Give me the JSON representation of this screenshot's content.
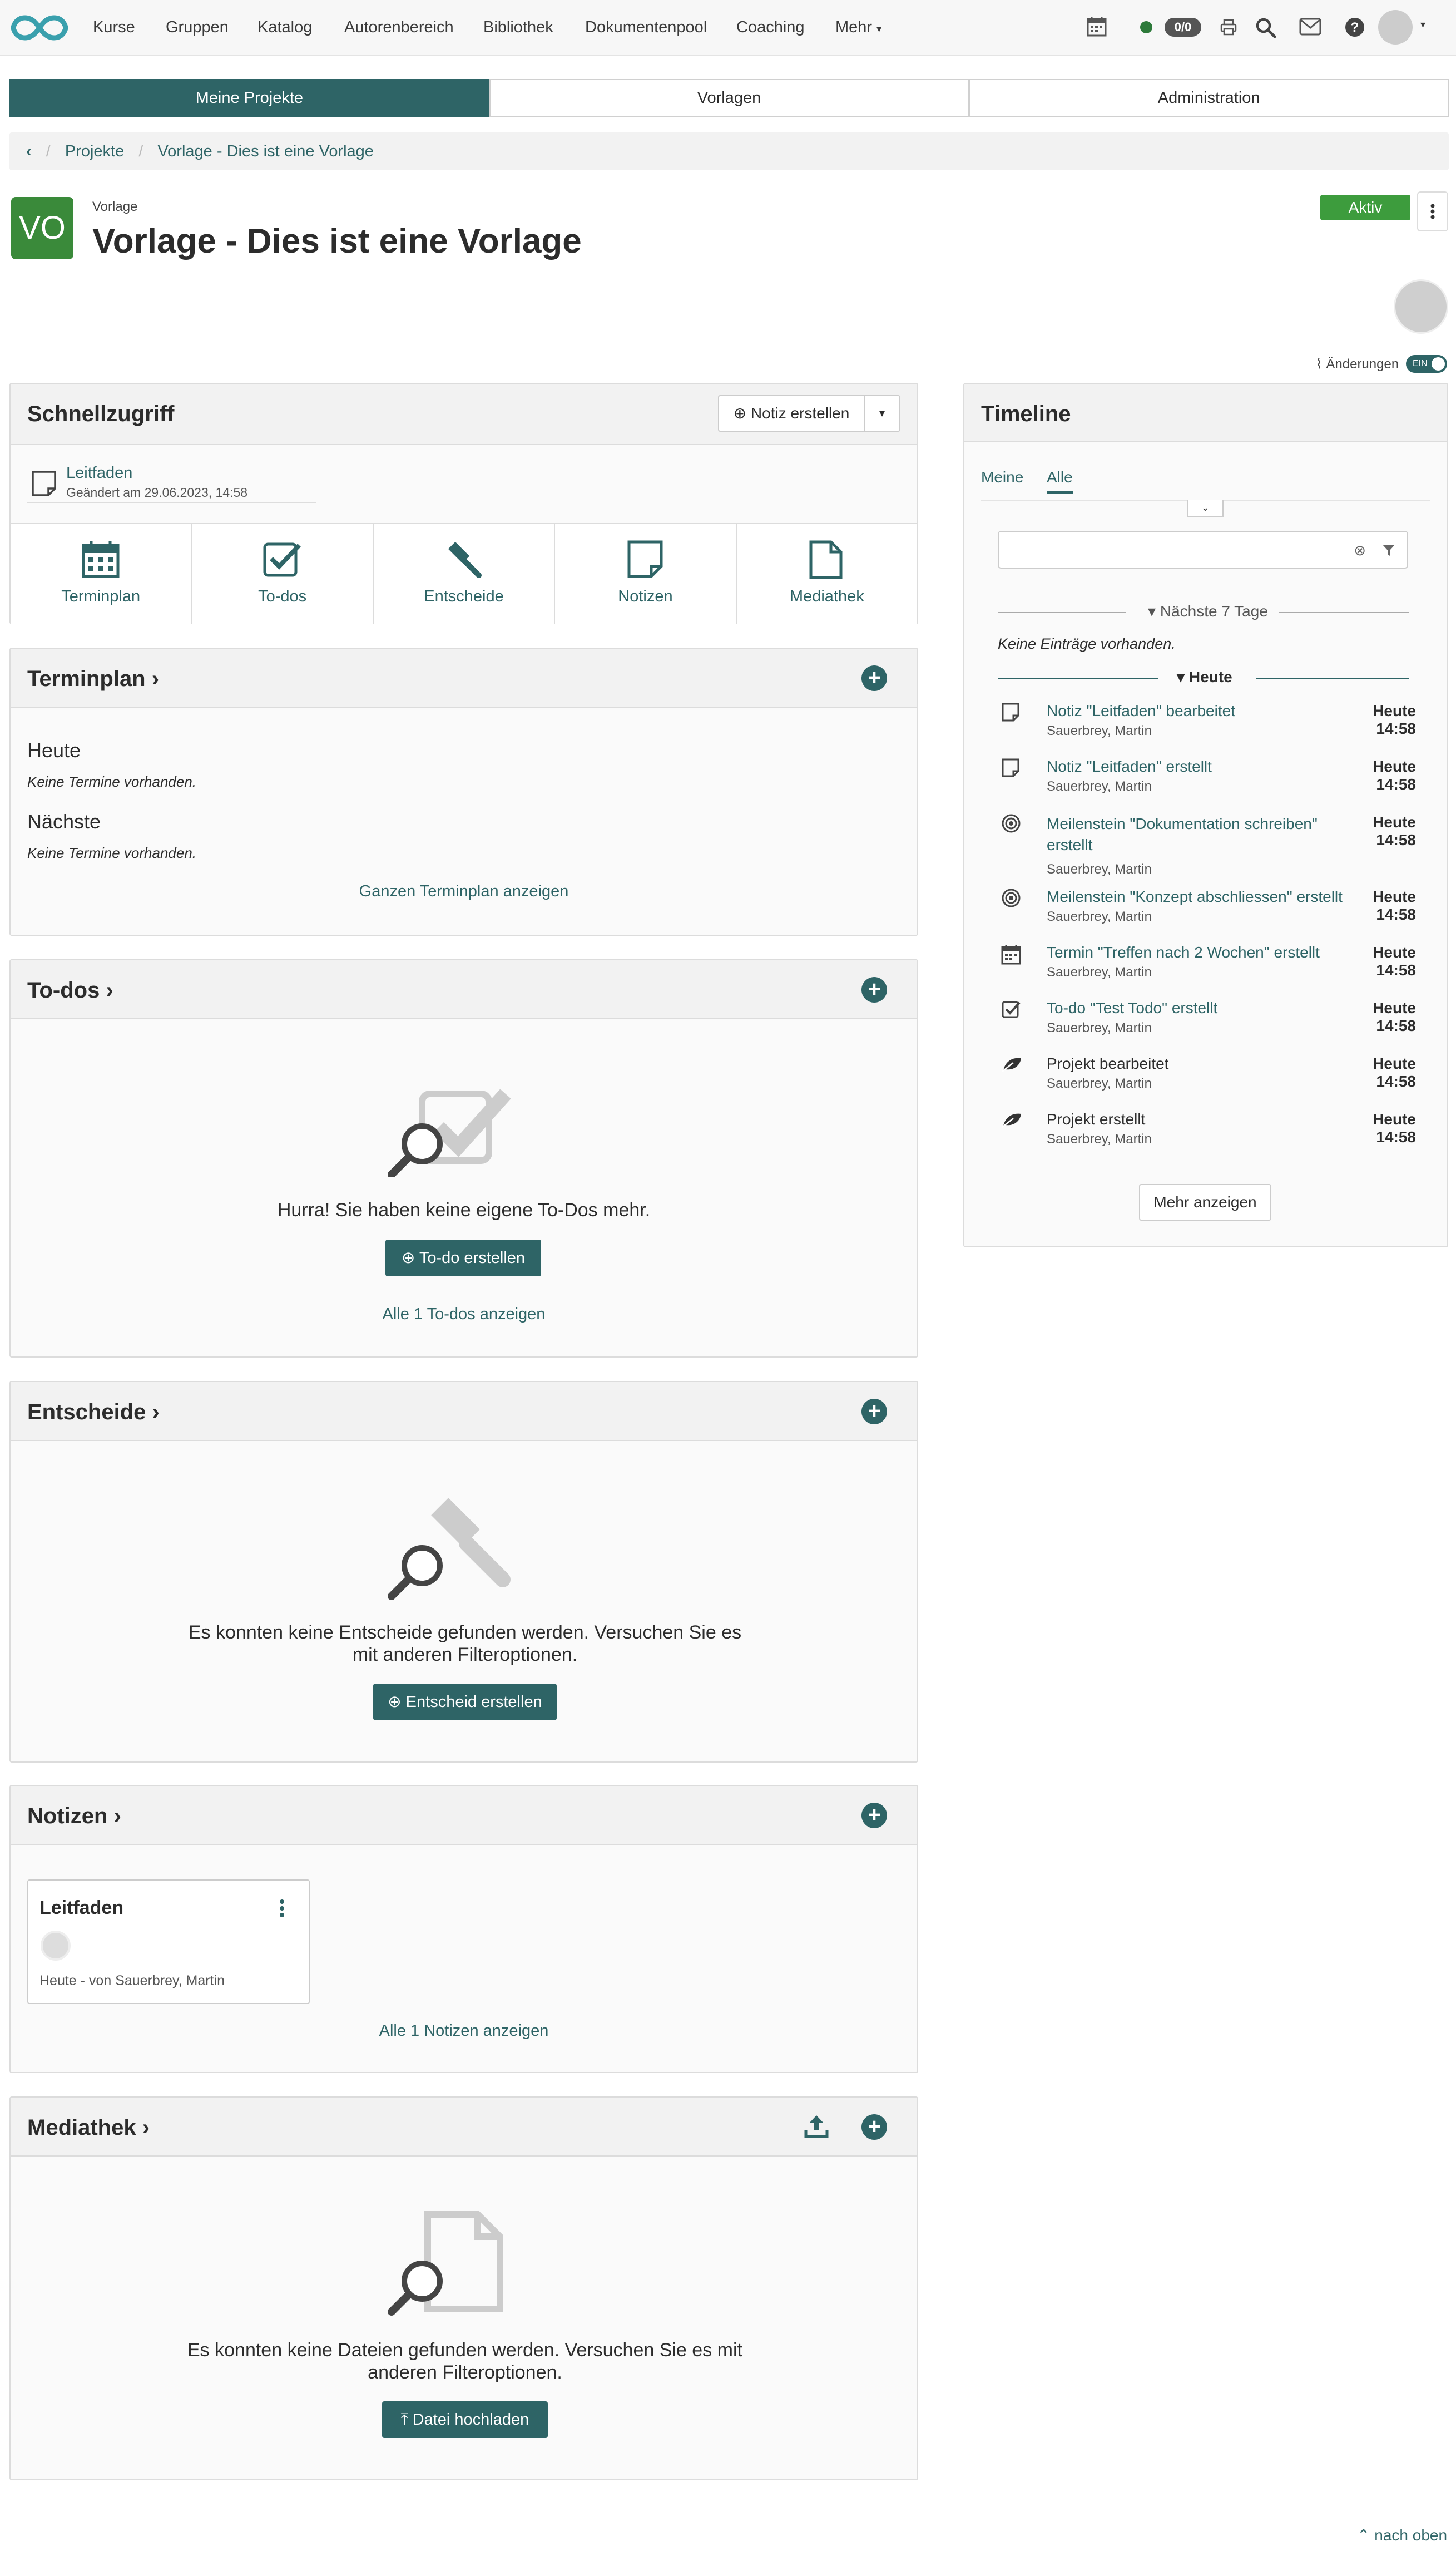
{
  "nav": {
    "items": [
      "Kurse",
      "Gruppen",
      "Katalog",
      "Autorenbereich",
      "Bibliothek",
      "Dokumentenpool",
      "Coaching",
      "Mehr"
    ],
    "counter": "0/0"
  },
  "tabs": [
    "Meine Projekte",
    "Vorlagen",
    "Administration"
  ],
  "breadcrumb": [
    "Projekte",
    "Vorlage - Dies ist eine Vorlage"
  ],
  "header": {
    "avatar_initials": "VO",
    "sublabel": "Vorlage",
    "title": "Vorlage - Dies ist eine Vorlage",
    "status": "Aktiv",
    "changes_label": "Änderungen",
    "toggle_label": "EIN"
  },
  "quick": {
    "title": "Schnellzugriff",
    "note_button": "Notiz erstellen",
    "recent_title": "Leitfaden",
    "recent_sub": "Geändert am 29.06.2023, 14:58",
    "tiles": [
      "Terminplan",
      "To-dos",
      "Entscheide",
      "Notizen",
      "Mediathek"
    ]
  },
  "schedule": {
    "title": "Terminplan",
    "today": "Heute",
    "today_empty": "Keine Termine vorhanden.",
    "next": "Nächste",
    "next_empty": "Keine Termine vorhanden.",
    "link": "Ganzen Terminplan anzeigen"
  },
  "todos": {
    "title": "To-dos",
    "empty": "Hurra! Sie haben keine eigene To-Dos mehr.",
    "button": "To-do erstellen",
    "link": "Alle 1 To-dos anzeigen"
  },
  "decisions": {
    "title": "Entscheide",
    "empty": "Es konnten keine Entscheide gefunden werden. Versuchen Sie es mit anderen Filteroptionen.",
    "button": "Entscheid erstellen"
  },
  "notes": {
    "title": "Notizen",
    "card_title": "Leitfaden",
    "card_meta": "Heute - von Sauerbrey, Martin",
    "link": "Alle 1 Notizen anzeigen"
  },
  "media": {
    "title": "Mediathek",
    "empty": "Es konnten keine Dateien gefunden werden. Versuchen Sie es mit anderen Filteroptionen.",
    "button": "Datei hochladen"
  },
  "timeline": {
    "title": "Timeline",
    "tabs": [
      "Meine",
      "Alle"
    ],
    "next7": "Nächste 7 Tage",
    "no_entries": "Keine Einträge vorhanden.",
    "today": "Heute",
    "entries": [
      {
        "text": "Notiz \"Leitfaden\" bearbeitet",
        "who": "Sauerbrey, Martin",
        "day": "Heute",
        "time": "14:58",
        "icon": "note-icon"
      },
      {
        "text": "Notiz \"Leitfaden\" erstellt",
        "who": "Sauerbrey, Martin",
        "day": "Heute",
        "time": "14:58",
        "icon": "note-icon"
      },
      {
        "text": "Meilenstein \"Dokumentation schreiben\" erstellt",
        "who": "Sauerbrey, Martin",
        "day": "Heute",
        "time": "14:58",
        "icon": "milestone-icon"
      },
      {
        "text": "Meilenstein \"Konzept abschliessen\" erstellt",
        "who": "Sauerbrey, Martin",
        "day": "Heute",
        "time": "14:58",
        "icon": "milestone-icon"
      },
      {
        "text": "Termin \"Treffen nach 2 Wochen\" erstellt",
        "who": "Sauerbrey, Martin",
        "day": "Heute",
        "time": "14:58",
        "icon": "calendar-icon"
      },
      {
        "text": "To-do \"Test Todo\" erstellt",
        "who": "Sauerbrey, Martin",
        "day": "Heute",
        "time": "14:58",
        "icon": "todo-icon"
      },
      {
        "text": "Projekt bearbeitet",
        "who": "Sauerbrey, Martin",
        "day": "Heute",
        "time": "14:58",
        "icon": "project-icon"
      },
      {
        "text": "Projekt erstellt",
        "who": "Sauerbrey, Martin",
        "day": "Heute",
        "time": "14:58",
        "icon": "project-icon"
      }
    ],
    "more": "Mehr anzeigen"
  },
  "footer": {
    "top": "nach oben"
  }
}
